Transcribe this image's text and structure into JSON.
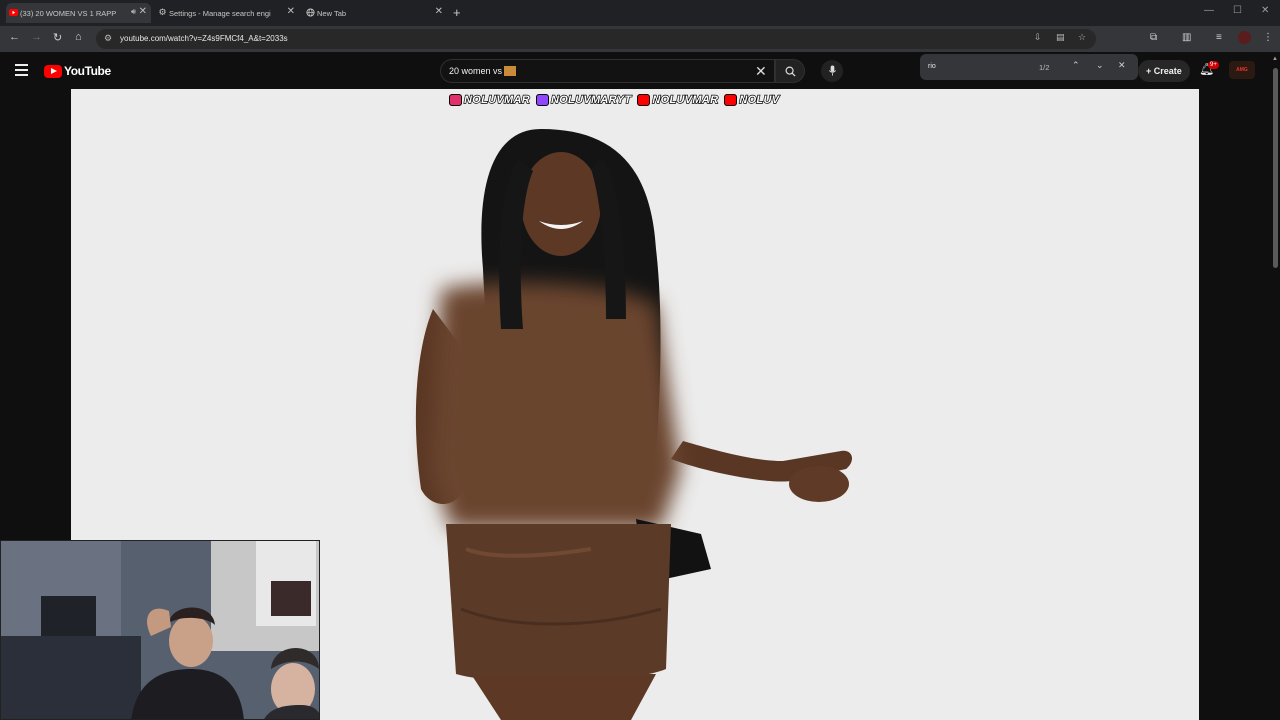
{
  "browser": {
    "tabs": [
      {
        "title": "(33) 20 WOMEN VS 1 RAPP"
      },
      {
        "title": "Settings - Manage search engi"
      },
      {
        "title": "New Tab"
      }
    ],
    "new_tab_symbol": "+",
    "url": "youtube.com/watch?v=Z4s9FMCf4_A&t=2033s"
  },
  "find_bar": {
    "query": "rio",
    "count": "1/2"
  },
  "youtube": {
    "logo_text": "YouTube",
    "search_query": "20 women vs",
    "search_highlight": "rio",
    "create_label": "Create",
    "notification_badge": "9+",
    "avatar_text": "AMG"
  },
  "video": {
    "handles": [
      {
        "text": "NOLUVMAR",
        "icon": "instagram-icon",
        "color": "#e1306c"
      },
      {
        "text": "NOLUVMARYT",
        "icon": "twitch-icon",
        "color": "#9146ff"
      },
      {
        "text": "NOLUVMAR",
        "icon": "youtube-icon",
        "color": "#ff0000"
      },
      {
        "text": "NOLUV",
        "icon": "youtube-icon",
        "color": "#ff0000"
      }
    ]
  },
  "colors": {
    "youtube_red": "#ff0000",
    "page_background": "#0f0f0f",
    "player_background": "#ececec"
  }
}
